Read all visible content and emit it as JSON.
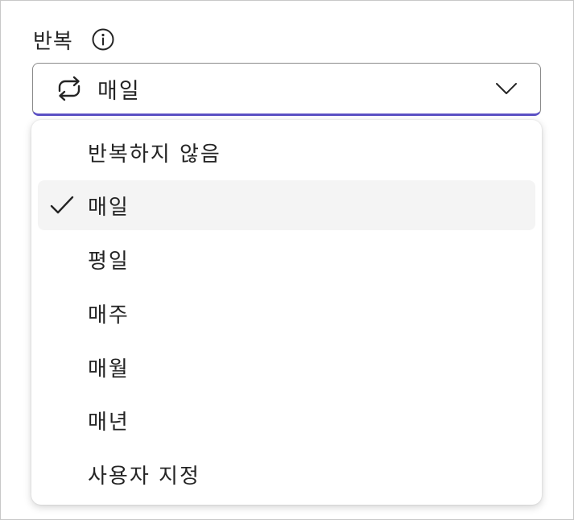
{
  "field": {
    "label": "반복",
    "info_icon": "info-icon"
  },
  "combo": {
    "icon": "repeat-icon",
    "value": "매일",
    "chevron": "chevron-down-icon"
  },
  "options": [
    {
      "label": "반복하지 않음",
      "selected": false
    },
    {
      "label": "매일",
      "selected": true
    },
    {
      "label": "평일",
      "selected": false
    },
    {
      "label": "매주",
      "selected": false
    },
    {
      "label": "매월",
      "selected": false
    },
    {
      "label": "매년",
      "selected": false
    },
    {
      "label": "사용자 지정",
      "selected": false
    }
  ],
  "colors": {
    "accent_underline": "#5b50c4",
    "selected_bg": "#f4f4f4",
    "text": "#242424"
  }
}
